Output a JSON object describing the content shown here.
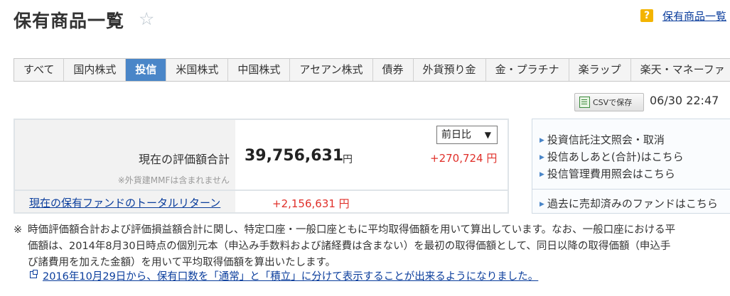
{
  "page": {
    "title": "保有商品一覧",
    "help_icon": "?",
    "help_link": "保有商品一覧"
  },
  "tabs": [
    {
      "label": "すべて",
      "active": false
    },
    {
      "label": "国内株式",
      "active": false
    },
    {
      "label": "投信",
      "active": true
    },
    {
      "label": "米国株式",
      "active": false
    },
    {
      "label": "中国株式",
      "active": false
    },
    {
      "label": "アセアン株式",
      "active": false
    },
    {
      "label": "債券",
      "active": false
    },
    {
      "label": "外貨預り金",
      "active": false
    },
    {
      "label": "金・プラチナ",
      "active": false
    },
    {
      "label": "楽ラップ",
      "active": false
    },
    {
      "label": "楽天・マネーファ",
      "active": false
    }
  ],
  "toolbar": {
    "csv_label": "CSVで保存",
    "timestamp": "06/30 22:47"
  },
  "summary": {
    "label": "現在の評価額合計",
    "note": "※外貨建MMFは含まれません",
    "value": "39,756,631",
    "value_unit": "円",
    "compare_select": "前日比",
    "change": "+270,724 円",
    "total_return_link": "現在の保有ファンドのトータルリターン",
    "total_return_value": "+2,156,631 円"
  },
  "side_links": {
    "items": [
      "投資信託注文照会・取消",
      "投信あしあと(合計)はこちら",
      "投信管理費用照会はこちら"
    ],
    "bottom": "過去に売却済みのファンドはこちら"
  },
  "note": {
    "mark": "※",
    "lines": [
      "時価評価額合計および評価損益額合計に関し、特定口座・一般口座ともに平均取得価額を用いて算出しています。なお、一般口座における平",
      "価額は、2014年8月30日時点の個別元本（申込み手数料および諸経費は含まない）を最初の取得価額として、同日以降の取得価額（申込手",
      "び諸費用を加えた金額）を用いて平均取得価額を算出いたします。"
    ],
    "info_link": "2016年10月29日から、保有口数を「通常」と「積立」に分けて表示することが出来るようになりました。"
  },
  "colors": {
    "active_tab": "#4a86c8",
    "positive": "#e0302a",
    "link": "#0a3d9c",
    "help_badge": "#f3b400"
  }
}
